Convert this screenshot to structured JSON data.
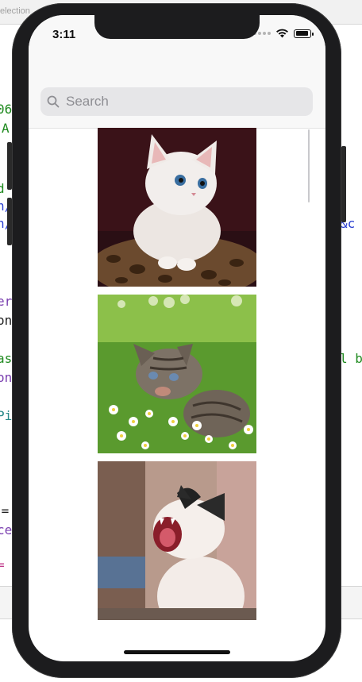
{
  "background_window": {
    "title_fragment": "election",
    "code_fragments": [
      {
        "text": "06",
        "color": "green"
      },
      {
        "text": "A",
        "color": "green"
      },
      {
        "text": "d",
        "color": "green"
      },
      {
        "text": "n/",
        "color": "blue"
      },
      {
        "text": "n/",
        "color": "blue"
      },
      {
        "text": "&c",
        "color": "blue"
      },
      {
        "text": "er",
        "color": "purple"
      },
      {
        "text": "on",
        "color": "black"
      },
      {
        "text": "as",
        "color": "green"
      },
      {
        "text": "l b",
        "color": "green"
      },
      {
        "text": "on",
        "color": "purple"
      },
      {
        "text": "Pi",
        "color": "teal"
      },
      {
        "text": " =",
        "color": "black"
      },
      {
        "text": "ce",
        "color": "purple"
      },
      {
        "text": "=",
        "color": "pink"
      }
    ]
  },
  "status_bar": {
    "time": "3:11"
  },
  "search": {
    "placeholder": "Search",
    "value": ""
  },
  "photos": [
    {
      "name": "white-kitten-photo",
      "subject": "white kitten on leopard cushion"
    },
    {
      "name": "tabby-kitten-photo",
      "subject": "tabby kitten in daisy grass"
    },
    {
      "name": "yawning-cat-photo",
      "subject": "white and black cat yawning"
    }
  ],
  "colors": {
    "device_frame": "#1c1c1e",
    "nav_background": "#f8f8f8",
    "search_field": "#e6e6e8",
    "placeholder": "#8e8e93"
  }
}
